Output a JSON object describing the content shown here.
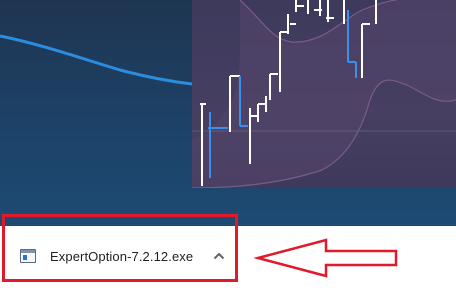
{
  "downloads": {
    "items": [
      {
        "file_name": "ExpertOption-7.2.12.exe",
        "icon": "executable-file-icon",
        "menu_icon": "chevron-up-icon"
      }
    ]
  },
  "annotations": {
    "highlight_color": "#e01a2a",
    "arrow_color": "#e01a2a"
  },
  "colors": {
    "page_background": "#1d4268",
    "chart_background": "#433d60",
    "line_accent": "#2a8de0",
    "candle_up": "#ffffff",
    "candle_down": "#3d8ee8",
    "download_bar": "#ffffff"
  }
}
